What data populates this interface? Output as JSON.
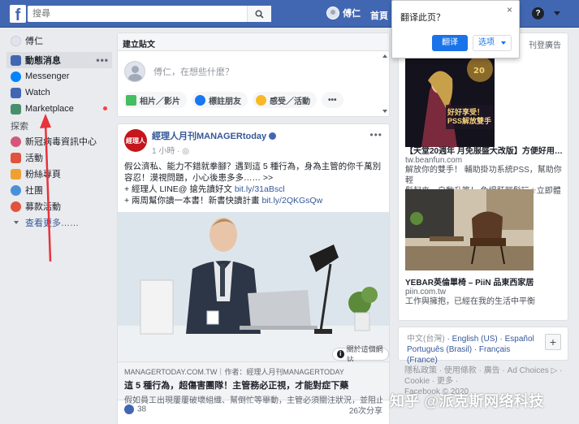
{
  "topbar": {
    "logo": "f",
    "search_placeholder": "搜尋",
    "user_name": "傅仁",
    "home": "首頁",
    "help": "?"
  },
  "sidebar": {
    "user_name": "傅仁",
    "items": [
      {
        "label": "動態消息",
        "icon": "news-feed-icon",
        "color": "#4267b2"
      },
      {
        "label": "Messenger",
        "icon": "messenger-icon",
        "color": "#0084ff"
      },
      {
        "label": "Watch",
        "icon": "watch-icon",
        "color": "#4267b2"
      },
      {
        "label": "Marketplace",
        "icon": "marketplace-icon",
        "color": "#4a8f6b"
      }
    ],
    "explore_title": "探索",
    "explore": [
      {
        "label": "新冠病毒資訊中心",
        "icon": "covid-info-icon",
        "color": "#d4577b"
      },
      {
        "label": "活動",
        "icon": "events-icon",
        "color": "#e0533c"
      },
      {
        "label": "粉絲專頁",
        "icon": "pages-icon",
        "color": "#f0a030"
      },
      {
        "label": "社團",
        "icon": "groups-icon",
        "color": "#4a90d9"
      },
      {
        "label": "募款活動",
        "icon": "fundraisers-icon",
        "color": "#e0533c"
      }
    ],
    "see_more": "查看更多……"
  },
  "composer": {
    "header": "建立貼文",
    "placeholder": "傅仁，在想些什麼？",
    "actions": [
      {
        "label": "相片／影片",
        "icon": "photo-icon",
        "color": "#45bd62"
      },
      {
        "label": "標註朋友",
        "icon": "tag-friends-icon",
        "color": "#1877f2"
      },
      {
        "label": "感受／活動",
        "icon": "feeling-icon",
        "color": "#f7b928"
      }
    ]
  },
  "post": {
    "page_name": "經理人月刊MANAGERtoday",
    "page_logo_text": "經理人",
    "time": "1 小時 · ",
    "text_line1": "假公濟私、能力不錯就拳腳？遇到這 5 種行為，身為主管的你千萬別容忍！漠視問題，小心後患多多…… >>",
    "text_line2_prefix": "+ 經理人 LINE@ 搶先讀好文 ",
    "text_line2_link": "bit.ly/31aBscl",
    "text_line3_prefix": "+ 兩周幫你讀一本書！新書快讀計畫 ",
    "text_line3_link": "bit.ly/2QKGsQw",
    "info_pill": "關於這個網站",
    "link_domain": "MANAGERTODAY.COM.TW｜作者：經理人月刊MANAGERTODAY",
    "link_title": "這 5 種行為，超傷害團隊！主管務必正視，才能對症下藥",
    "link_desc": "假如員工出現屢屢破壞組織、幫倒忙等舉動，主管必須關注狀況，並阻止員工做出這些行為。",
    "likes": "38",
    "shares": "26次分享"
  },
  "ads": {
    "header": "刊登廣告",
    "ad1": {
      "badge": "好好享受！PSS解放雙手",
      "title": "【天堂20週年 月免服盛大改版】方便好用…",
      "domain": "tw.beanfun.com",
      "desc1": "解放你的雙手！ 輔助掛功系統PSS，幫助你輕",
      "desc2": "鬆起來，自動升等！ 免爆肝輕鬆玩☆立即體驗"
    },
    "ad2": {
      "title": "YEBAR英倫單椅 – PiiN 品東西家居",
      "domain": "piin.com.tw",
      "desc": "工作與擁抱，已經在我的生活中平衡"
    }
  },
  "languages": {
    "current": "中文(台灣)",
    "others": [
      "English (US)",
      "Español",
      "Português (Brasil)",
      "Français (France)"
    ],
    "plus": "+"
  },
  "footer": {
    "line1": "隱私政策 · 使用條款 · 廣告 · Ad Choices ▷ ·",
    "line2": "Cookie · 更多 ·",
    "line3": "Facebook © 2020"
  },
  "translate_popup": {
    "title": "翻译此页？",
    "translate_btn": "翻译",
    "options_btn": "选项",
    "close": "×"
  },
  "watermark": "知乎 @派克斯网络科技",
  "colors": {
    "topbar": "#4267b2",
    "link": "#365899",
    "annotation_arrow": "#e8323c"
  }
}
